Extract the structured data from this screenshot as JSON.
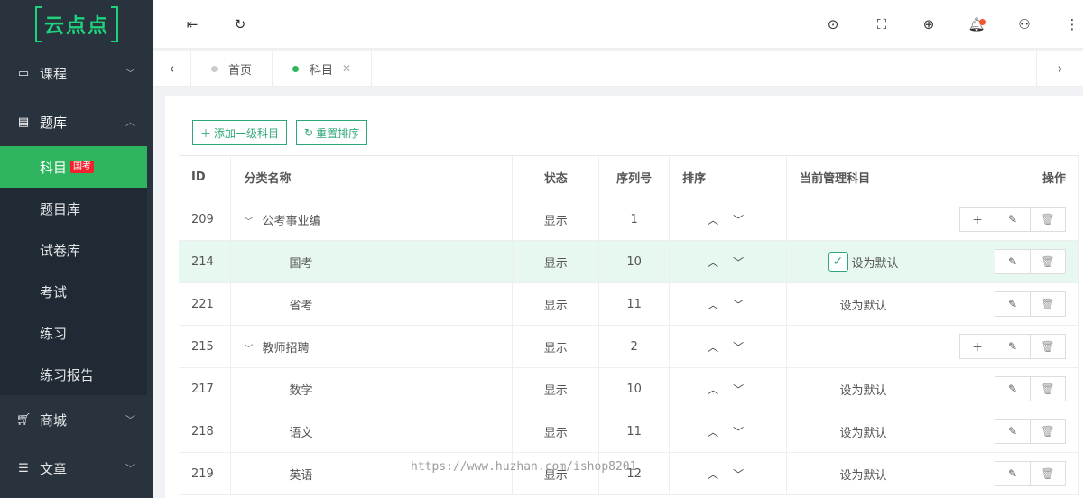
{
  "logo": "云点点",
  "sidebar": {
    "groups": [
      {
        "label": "课程",
        "icon": "video-icon"
      },
      {
        "label": "题库",
        "icon": "list-icon"
      },
      {
        "label": "商城",
        "icon": "cart-icon"
      },
      {
        "label": "文章",
        "icon": "article-icon"
      }
    ],
    "sub_items": [
      {
        "label": "科目",
        "badge": "国考"
      },
      {
        "label": "题目库"
      },
      {
        "label": "试卷库"
      },
      {
        "label": "考试"
      },
      {
        "label": "练习"
      },
      {
        "label": "练习报告"
      }
    ]
  },
  "tabs": [
    {
      "label": "首页"
    },
    {
      "label": "科目"
    }
  ],
  "toolbar": {
    "add_label": "添加一级科目",
    "reset_label": "重置排序"
  },
  "table": {
    "headers": [
      "ID",
      "分类名称",
      "状态",
      "序列号",
      "排序",
      "当前管理科目",
      "操作"
    ],
    "rows": [
      {
        "id": "209",
        "name": "公考事业编",
        "status": "显示",
        "seq": "1",
        "default": ""
      },
      {
        "id": "214",
        "name": "国考",
        "status": "显示",
        "seq": "10",
        "default": "设为默认"
      },
      {
        "id": "221",
        "name": "省考",
        "status": "显示",
        "seq": "11",
        "default": "设为默认"
      },
      {
        "id": "215",
        "name": "教师招聘",
        "status": "显示",
        "seq": "2",
        "default": ""
      },
      {
        "id": "217",
        "name": "数学",
        "status": "显示",
        "seq": "10",
        "default": "设为默认"
      },
      {
        "id": "218",
        "name": "语文",
        "status": "显示",
        "seq": "11",
        "default": "设为默认"
      },
      {
        "id": "219",
        "name": "英语",
        "status": "显示",
        "seq": "12",
        "default": "设为默认"
      }
    ]
  },
  "watermark": "https://www.huzhan.com/ishop8201",
  "colors": {
    "accent": "#2fb55f",
    "sidebar": "#28333e",
    "highlight_row": "#e6f8ef"
  }
}
